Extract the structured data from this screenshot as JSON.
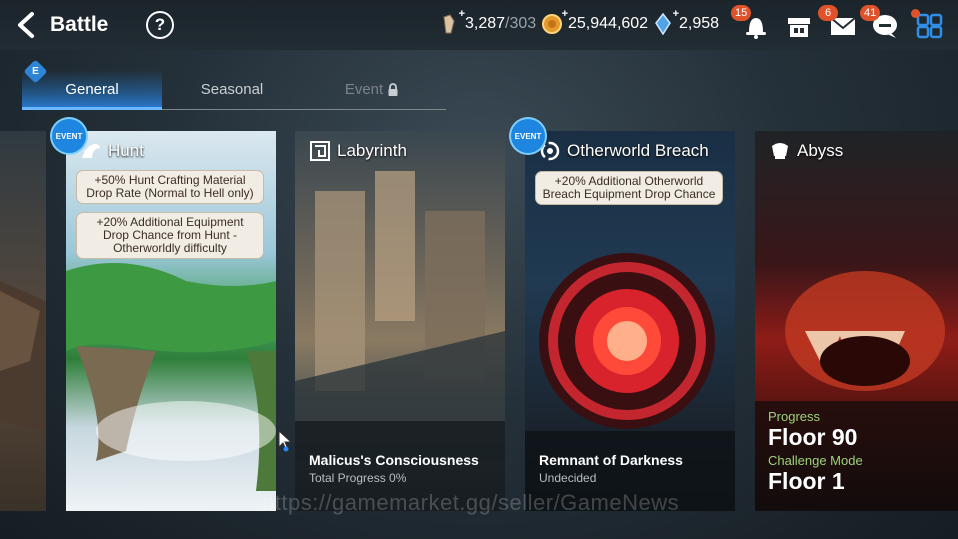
{
  "header": {
    "title": "Battle",
    "help_label": "?",
    "stamina": {
      "value": "3,287",
      "max": "/303"
    },
    "gold": {
      "value": "25,944,602"
    },
    "skystone": {
      "value": "2,958"
    },
    "notifications_badge": "15",
    "mail_badge": "6",
    "chat_badge": "41"
  },
  "tabs": {
    "marker": "E",
    "items": [
      {
        "label": "General"
      },
      {
        "label": "Seasonal"
      },
      {
        "label": "Event"
      }
    ]
  },
  "cards": {
    "hunt": {
      "event_label": "EVENT",
      "name": "Hunt",
      "bonus1": "+50% Hunt Crafting Material Drop Rate (Normal to Hell only)",
      "bonus2": "+20% Additional Equipment Drop Chance from Hunt - Otherworldly difficulty"
    },
    "labyrinth": {
      "name": "Labyrinth",
      "title": "Malicus's Consciousness",
      "subtitle": "Total Progress 0%"
    },
    "breach": {
      "event_label": "EVENT",
      "name": "Otherworld Breach",
      "bonus1": "+20% Additional Otherworld Breach Equipment Drop Chance",
      "title": "Remnant of Darkness",
      "subtitle": "Undecided"
    },
    "abyss": {
      "name": "Abyss",
      "progress_label": "Progress",
      "progress_value": "Floor 90",
      "challenge_label": "Challenge Mode",
      "challenge_value": "Floor 1"
    }
  },
  "watermark": "https://gamemarket.gg/seller/GameNews",
  "colors": {
    "accent": "#2a7bd0",
    "badge": "#e0532a",
    "progress_green": "#9fd27a"
  }
}
